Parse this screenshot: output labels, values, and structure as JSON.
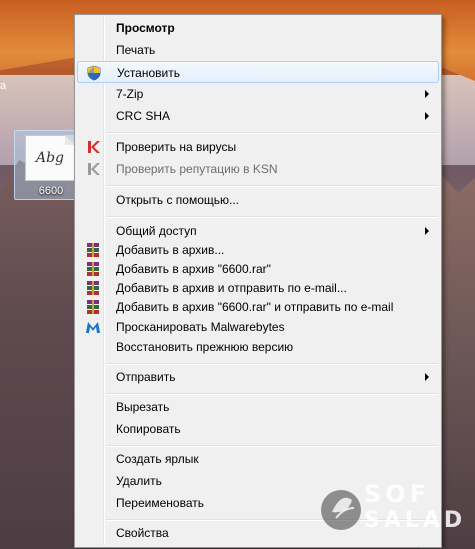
{
  "desktop": {
    "edge_char": "а",
    "file": {
      "thumbnail_text": "Abg",
      "label": "6600"
    }
  },
  "menu": {
    "items": [
      {
        "label": "Просмотр",
        "bold": true
      },
      {
        "label": "Печать"
      },
      {
        "label": "Установить",
        "icon": "uac-shield-icon",
        "highlighted": true
      },
      {
        "label": "7-Zip",
        "submenu": true
      },
      {
        "label": "CRC SHA",
        "submenu": true
      },
      {
        "label": "Проверить на вирусы",
        "icon": "kaspersky-icon"
      },
      {
        "label": "Проверить репутацию в KSN",
        "icon": "kaspersky-ksn-icon",
        "disabled": true
      },
      {
        "label": "Открыть с помощью..."
      },
      {
        "label": "Общий доступ",
        "submenu": true
      },
      {
        "label": "Добавить в архив...",
        "icon": "winrar-icon"
      },
      {
        "label": "Добавить в архив \"6600.rar\"",
        "icon": "winrar-icon"
      },
      {
        "label": "Добавить в архив и отправить по e-mail...",
        "icon": "winrar-icon"
      },
      {
        "label": "Добавить в архив \"6600.rar\" и отправить по e-mail",
        "icon": "winrar-icon"
      },
      {
        "label": "Просканировать Malwarebytes",
        "icon": "malwarebytes-icon"
      },
      {
        "label": "Восстановить прежнюю версию"
      },
      {
        "label": "Отправить",
        "submenu": true
      },
      {
        "label": "Вырезать"
      },
      {
        "label": "Копировать"
      },
      {
        "label": "Создать ярлык"
      },
      {
        "label": "Удалить"
      },
      {
        "label": "Переименовать"
      },
      {
        "label": "Свойства"
      }
    ]
  },
  "watermark": {
    "line1": "SOF",
    "line2": "SALAD"
  },
  "colors": {
    "menu_bg": "#f0f0f0",
    "highlight_border": "#aecff7",
    "disabled_text": "#6d6d6d"
  }
}
